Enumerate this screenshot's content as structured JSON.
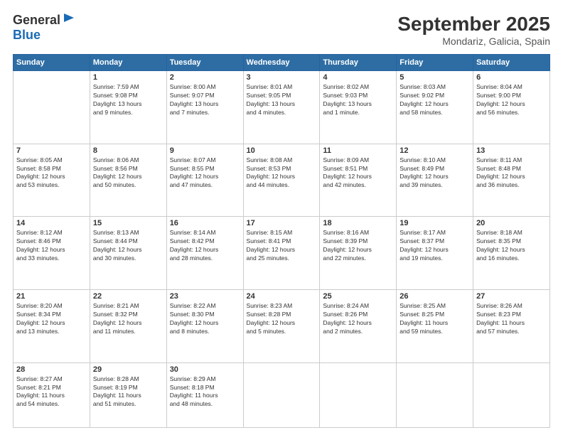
{
  "header": {
    "logo_line1": "General",
    "logo_line2": "Blue",
    "month_year": "September 2025",
    "location": "Mondariz, Galicia, Spain"
  },
  "weekdays": [
    "Sunday",
    "Monday",
    "Tuesday",
    "Wednesday",
    "Thursday",
    "Friday",
    "Saturday"
  ],
  "weeks": [
    [
      {
        "day": "",
        "info": ""
      },
      {
        "day": "1",
        "info": "Sunrise: 7:59 AM\nSunset: 9:08 PM\nDaylight: 13 hours\nand 9 minutes."
      },
      {
        "day": "2",
        "info": "Sunrise: 8:00 AM\nSunset: 9:07 PM\nDaylight: 13 hours\nand 7 minutes."
      },
      {
        "day": "3",
        "info": "Sunrise: 8:01 AM\nSunset: 9:05 PM\nDaylight: 13 hours\nand 4 minutes."
      },
      {
        "day": "4",
        "info": "Sunrise: 8:02 AM\nSunset: 9:03 PM\nDaylight: 13 hours\nand 1 minute."
      },
      {
        "day": "5",
        "info": "Sunrise: 8:03 AM\nSunset: 9:02 PM\nDaylight: 12 hours\nand 58 minutes."
      },
      {
        "day": "6",
        "info": "Sunrise: 8:04 AM\nSunset: 9:00 PM\nDaylight: 12 hours\nand 56 minutes."
      }
    ],
    [
      {
        "day": "7",
        "info": "Sunrise: 8:05 AM\nSunset: 8:58 PM\nDaylight: 12 hours\nand 53 minutes."
      },
      {
        "day": "8",
        "info": "Sunrise: 8:06 AM\nSunset: 8:56 PM\nDaylight: 12 hours\nand 50 minutes."
      },
      {
        "day": "9",
        "info": "Sunrise: 8:07 AM\nSunset: 8:55 PM\nDaylight: 12 hours\nand 47 minutes."
      },
      {
        "day": "10",
        "info": "Sunrise: 8:08 AM\nSunset: 8:53 PM\nDaylight: 12 hours\nand 44 minutes."
      },
      {
        "day": "11",
        "info": "Sunrise: 8:09 AM\nSunset: 8:51 PM\nDaylight: 12 hours\nand 42 minutes."
      },
      {
        "day": "12",
        "info": "Sunrise: 8:10 AM\nSunset: 8:49 PM\nDaylight: 12 hours\nand 39 minutes."
      },
      {
        "day": "13",
        "info": "Sunrise: 8:11 AM\nSunset: 8:48 PM\nDaylight: 12 hours\nand 36 minutes."
      }
    ],
    [
      {
        "day": "14",
        "info": "Sunrise: 8:12 AM\nSunset: 8:46 PM\nDaylight: 12 hours\nand 33 minutes."
      },
      {
        "day": "15",
        "info": "Sunrise: 8:13 AM\nSunset: 8:44 PM\nDaylight: 12 hours\nand 30 minutes."
      },
      {
        "day": "16",
        "info": "Sunrise: 8:14 AM\nSunset: 8:42 PM\nDaylight: 12 hours\nand 28 minutes."
      },
      {
        "day": "17",
        "info": "Sunrise: 8:15 AM\nSunset: 8:41 PM\nDaylight: 12 hours\nand 25 minutes."
      },
      {
        "day": "18",
        "info": "Sunrise: 8:16 AM\nSunset: 8:39 PM\nDaylight: 12 hours\nand 22 minutes."
      },
      {
        "day": "19",
        "info": "Sunrise: 8:17 AM\nSunset: 8:37 PM\nDaylight: 12 hours\nand 19 minutes."
      },
      {
        "day": "20",
        "info": "Sunrise: 8:18 AM\nSunset: 8:35 PM\nDaylight: 12 hours\nand 16 minutes."
      }
    ],
    [
      {
        "day": "21",
        "info": "Sunrise: 8:20 AM\nSunset: 8:34 PM\nDaylight: 12 hours\nand 13 minutes."
      },
      {
        "day": "22",
        "info": "Sunrise: 8:21 AM\nSunset: 8:32 PM\nDaylight: 12 hours\nand 11 minutes."
      },
      {
        "day": "23",
        "info": "Sunrise: 8:22 AM\nSunset: 8:30 PM\nDaylight: 12 hours\nand 8 minutes."
      },
      {
        "day": "24",
        "info": "Sunrise: 8:23 AM\nSunset: 8:28 PM\nDaylight: 12 hours\nand 5 minutes."
      },
      {
        "day": "25",
        "info": "Sunrise: 8:24 AM\nSunset: 8:26 PM\nDaylight: 12 hours\nand 2 minutes."
      },
      {
        "day": "26",
        "info": "Sunrise: 8:25 AM\nSunset: 8:25 PM\nDaylight: 11 hours\nand 59 minutes."
      },
      {
        "day": "27",
        "info": "Sunrise: 8:26 AM\nSunset: 8:23 PM\nDaylight: 11 hours\nand 57 minutes."
      }
    ],
    [
      {
        "day": "28",
        "info": "Sunrise: 8:27 AM\nSunset: 8:21 PM\nDaylight: 11 hours\nand 54 minutes."
      },
      {
        "day": "29",
        "info": "Sunrise: 8:28 AM\nSunset: 8:19 PM\nDaylight: 11 hours\nand 51 minutes."
      },
      {
        "day": "30",
        "info": "Sunrise: 8:29 AM\nSunset: 8:18 PM\nDaylight: 11 hours\nand 48 minutes."
      },
      {
        "day": "",
        "info": ""
      },
      {
        "day": "",
        "info": ""
      },
      {
        "day": "",
        "info": ""
      },
      {
        "day": "",
        "info": ""
      }
    ]
  ]
}
